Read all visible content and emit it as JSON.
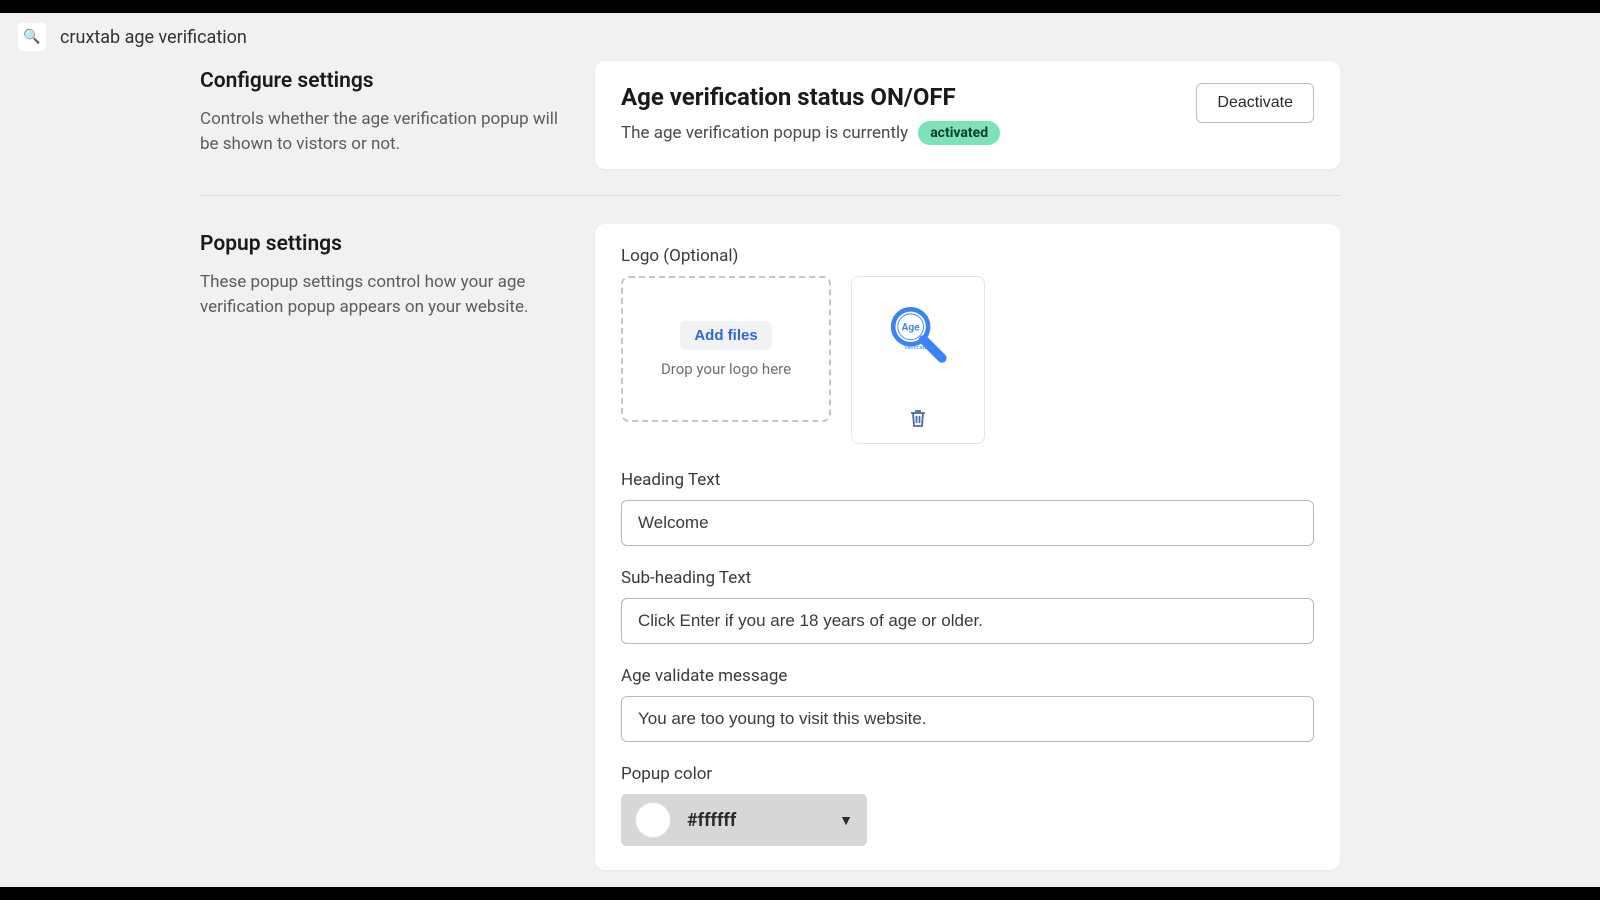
{
  "header": {
    "icon": "🔍",
    "title": "cruxtab age verification"
  },
  "configure": {
    "heading": "Configure settings",
    "description": "Controls whether the age verification popup will be shown to vistors or not."
  },
  "status": {
    "title": "Age verification status ON/OFF",
    "line_prefix": "The age verification popup is currently",
    "badge": "activated",
    "deactivate_label": "Deactivate"
  },
  "popup": {
    "heading": "Popup settings",
    "description": "These popup settings control how your age verification popup appears on your website.",
    "logo_label": "Logo (Optional)",
    "add_files_label": "Add files",
    "drop_hint": "Drop your logo here",
    "logo_badge_text": "Age",
    "logo_subtext": "Verification",
    "heading_text_label": "Heading Text",
    "heading_text_value": "Welcome",
    "subheading_label": "Sub-heading Text",
    "subheading_value": "Click Enter if you are 18 years of age or older.",
    "validate_label": "Age validate message",
    "validate_value": "You are too young to visit this website.",
    "popup_color_label": "Popup color",
    "popup_color_value": "#ffffff"
  }
}
